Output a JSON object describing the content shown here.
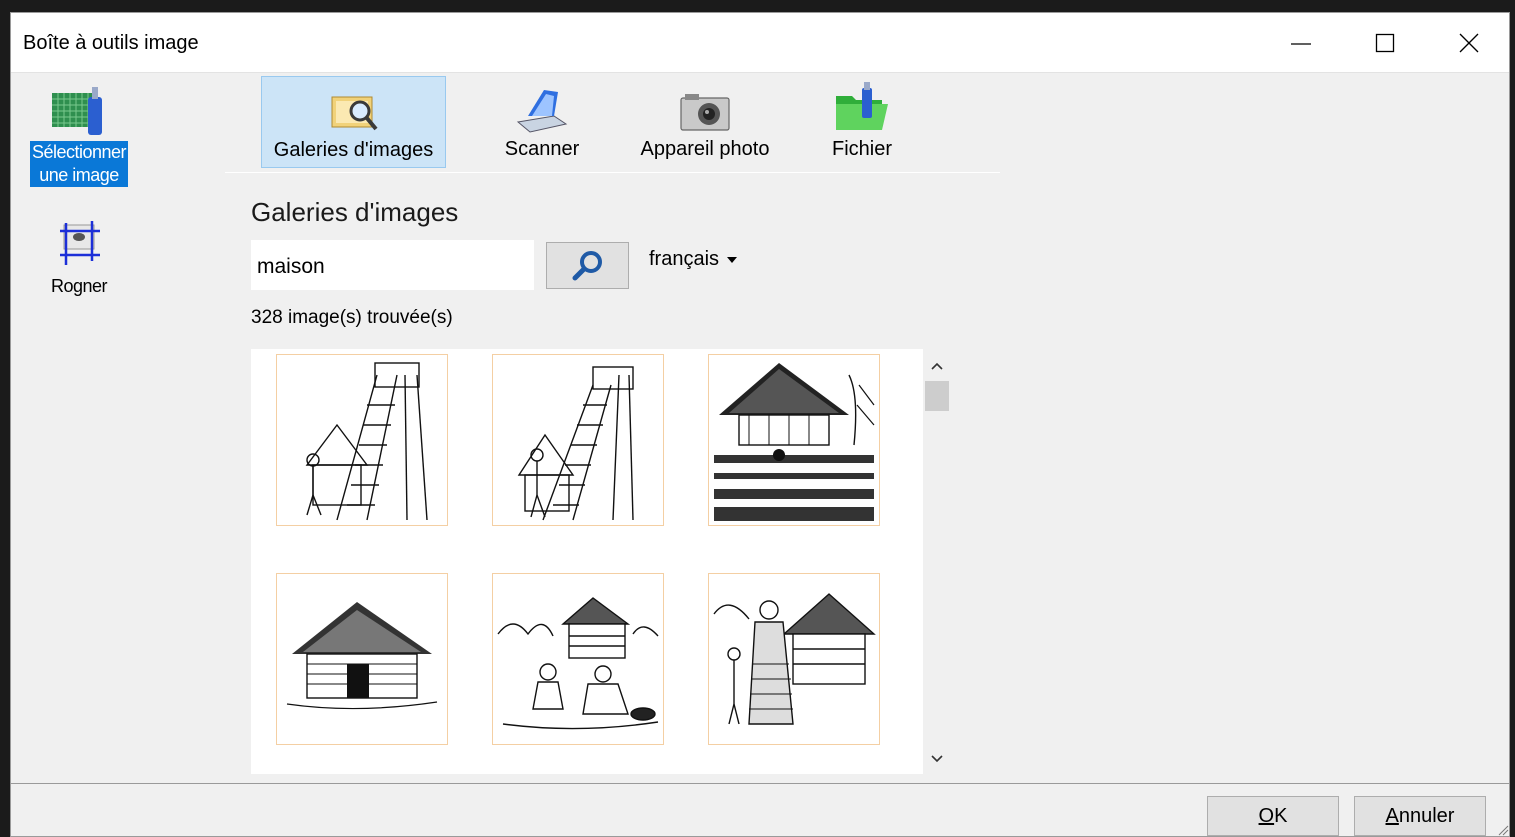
{
  "window": {
    "title": "Boîte à outils image"
  },
  "left_panel": {
    "items": [
      {
        "label_line1": "Sélectionner",
        "label_line2": "une image",
        "icon": "select-image-icon",
        "selected": true
      },
      {
        "label": "Rogner",
        "icon": "crop-icon",
        "selected": false
      }
    ]
  },
  "tabs": [
    {
      "label": "Galeries d'images",
      "icon": "image-gallery-icon",
      "selected": true
    },
    {
      "label": "Scanner",
      "icon": "scanner-icon",
      "selected": false
    },
    {
      "label": "Appareil photo",
      "icon": "camera-icon",
      "selected": false
    },
    {
      "label": "Fichier",
      "icon": "folder-icon",
      "selected": false
    }
  ],
  "gallery": {
    "title": "Galeries d'images",
    "search_value": "maison",
    "language": "français",
    "result_count": "328 image(s) trouvée(s)",
    "thumbnails": [
      {
        "icon": "watchtower-illustration"
      },
      {
        "icon": "watchtower-illustration"
      },
      {
        "icon": "thatched-house-garden-illustration"
      },
      {
        "icon": "thatched-house-illustration"
      },
      {
        "icon": "village-people-illustration"
      },
      {
        "icon": "mother-children-house-illustration"
      }
    ]
  },
  "buttons": {
    "ok_mnemonic": "O",
    "ok_rest": "K",
    "cancel_mnemonic": "A",
    "cancel_rest": "nnuler"
  },
  "colors": {
    "selection": "#0a78d7",
    "tab_selected_bg": "#cce4f7",
    "tab_selected_border": "#99c9ef",
    "thumb_border": "#f4cfa3",
    "search_icon": "#1f5aa6"
  }
}
